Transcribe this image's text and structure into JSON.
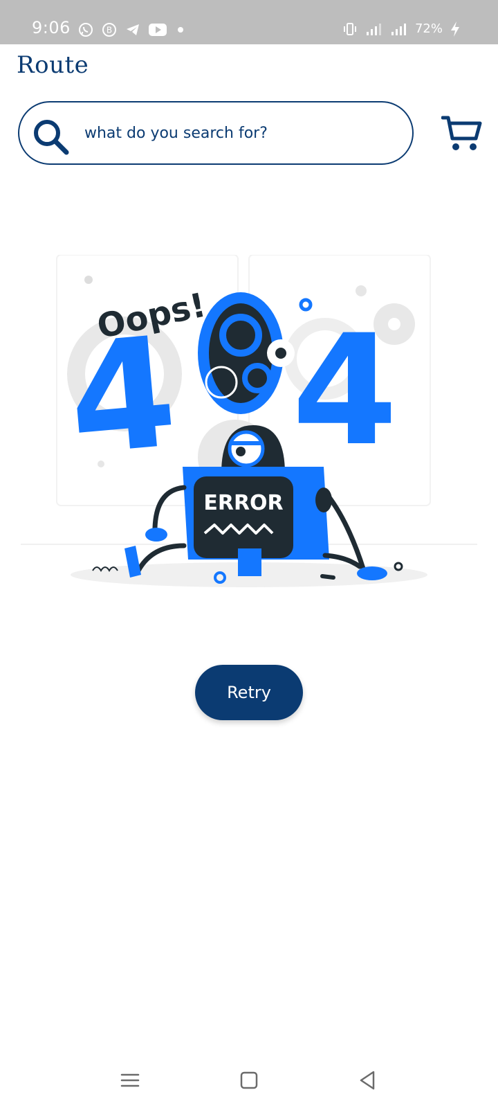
{
  "status_bar": {
    "time": "9:06",
    "battery": "72%",
    "notification_icons": [
      "whatsapp-icon",
      "b-icon",
      "telegram-icon",
      "youtube-icon",
      "dot-icon"
    ]
  },
  "header": {
    "brand": "Route",
    "search_placeholder": "what do you search for?"
  },
  "error": {
    "oops_text": "Oops!",
    "code_left": "4",
    "code_right": "4",
    "screen_text": "ERROR"
  },
  "actions": {
    "retry_label": "Retry"
  },
  "colors": {
    "primary": "#0b3b72",
    "accent_blue": "#1477ff",
    "dark": "#1f2b33",
    "status_bar_bg": "#bdbdbd"
  }
}
